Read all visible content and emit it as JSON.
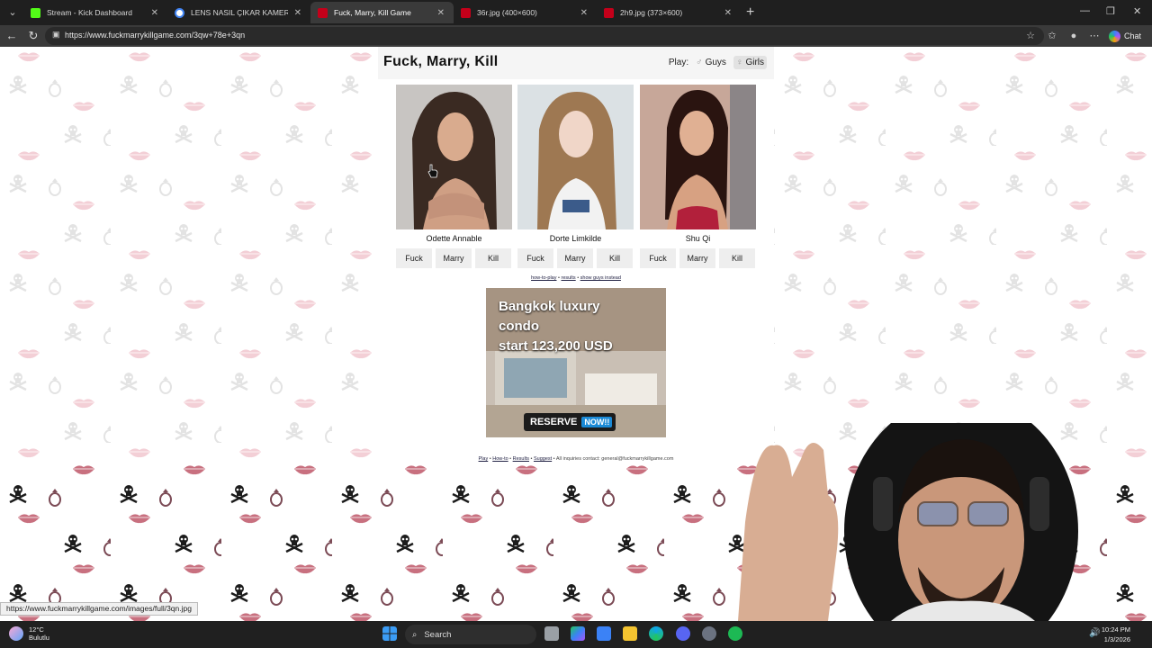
{
  "browser": {
    "tabs": [
      {
        "title": "Stream - Kick Dashboard",
        "color": "#53fc18",
        "active": false
      },
      {
        "title": "LENS NASIL ÇIKAR KAMERA - Goo",
        "color": "#4285f4",
        "active": false
      },
      {
        "title": "Fuck, Marry, Kill Game",
        "color": "#c4001a",
        "active": true
      },
      {
        "title": "36r.jpg (400×600)",
        "color": "#c4001a",
        "active": false
      },
      {
        "title": "2h9.jpg (373×600)",
        "color": "#c4001a",
        "active": false
      }
    ],
    "new_tab_label": "+",
    "url": "https://www.fuckmarrykillgame.com/3qw+78e+3qn",
    "chat_label": "Chat"
  },
  "page": {
    "title": "Fuck, Marry, Kill",
    "play_label": "Play:",
    "play_options": [
      "Guys",
      "Girls"
    ],
    "play_selected": "Girls",
    "people": [
      {
        "name": "Odette Annable",
        "hair": "#3a2a22",
        "bg": "#c9c6c3"
      },
      {
        "name": "Dorte Limkilde",
        "hair": "#a07a52",
        "bg": "#dde3e6"
      },
      {
        "name": "Shu Qi",
        "hair": "#2a1410",
        "bg": "#c9a99a"
      }
    ],
    "choices": [
      "Fuck",
      "Marry",
      "Kill"
    ],
    "links": {
      "how_to_play": "how-to-play",
      "sep1": " • ",
      "results": "results",
      "sep2": " • ",
      "show_guys": "show guys instead"
    },
    "ad": {
      "headline_line1": "Bangkok luxury",
      "headline_line2": "condo",
      "headline_line3": "start 123,200 USD",
      "button_main": "RESERVE",
      "button_now": "NOW!!"
    },
    "footer": {
      "play": "Play",
      "how_to": "How-to",
      "results": "Results",
      "suggest": "Suggest",
      "contact": " • All inquiries contact: general@fuckmarrykillgame.com"
    },
    "status_url": "https://www.fuckmarrykillgame.com/images/full/3qn.jpg"
  },
  "taskbar": {
    "temperature": "12°C",
    "weather": "Bulutlu",
    "search_placeholder": "Search",
    "time": "10:24 PM",
    "date": "1/3/2026"
  }
}
